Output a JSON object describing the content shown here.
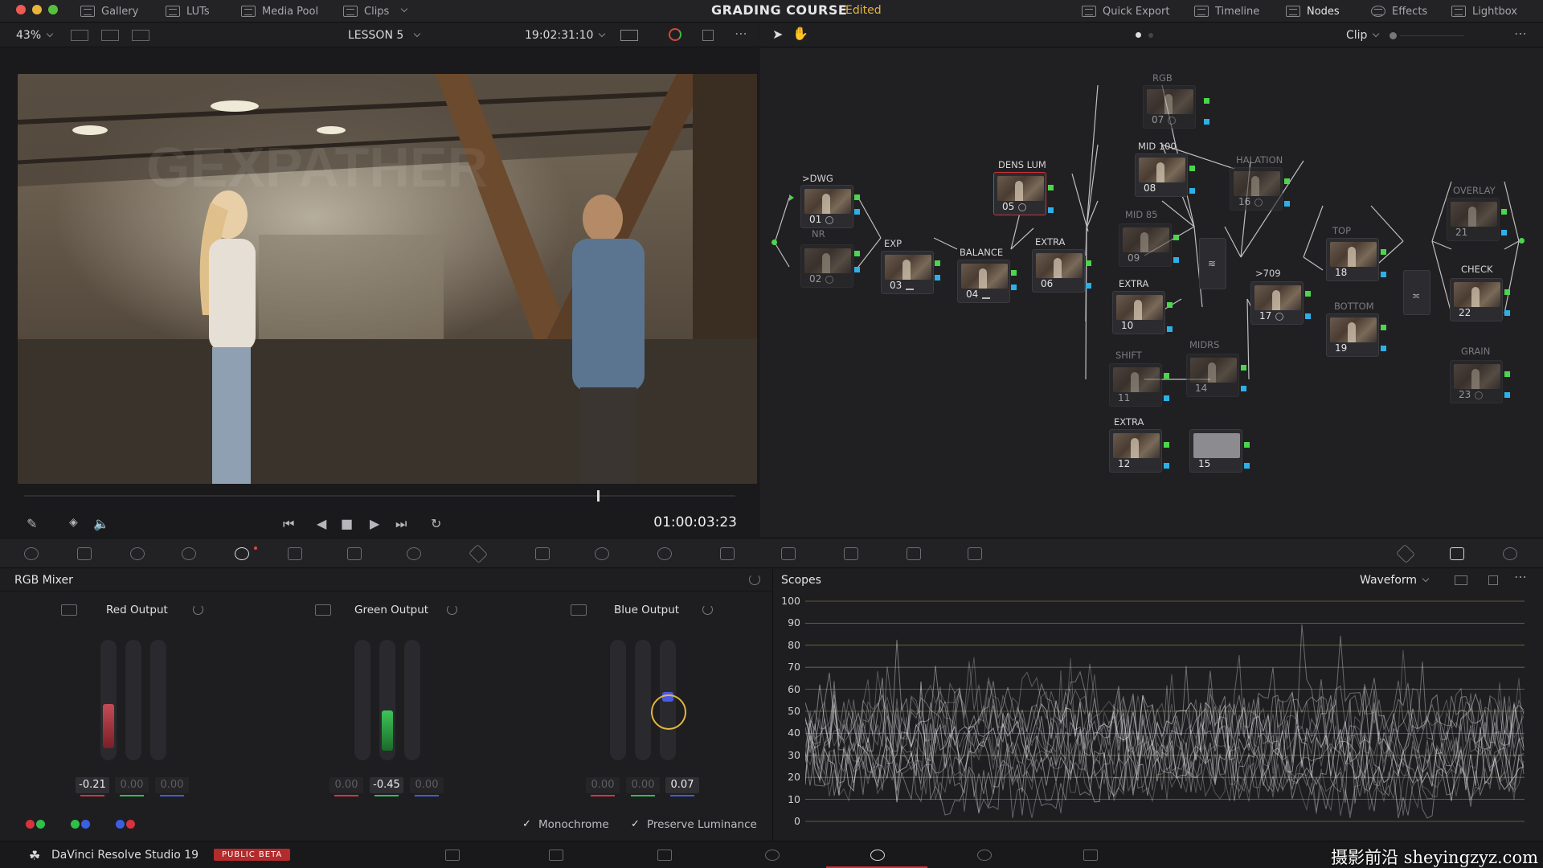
{
  "topbar": {
    "tabs": [
      {
        "label": "Gallery",
        "icon": "gallery-icon"
      },
      {
        "label": "LUTs",
        "icon": "luts-icon"
      },
      {
        "label": "Media Pool",
        "icon": "media-pool-icon"
      },
      {
        "label": "Clips",
        "icon": "clips-icon"
      }
    ],
    "project_title": "GRADING COURSE",
    "project_status": "Edited",
    "right_tabs": [
      {
        "label": "Quick Export",
        "icon": "export-icon"
      },
      {
        "label": "Timeline",
        "icon": "timeline-icon"
      },
      {
        "label": "Nodes",
        "icon": "nodes-icon"
      },
      {
        "label": "Effects",
        "icon": "effects-icon"
      },
      {
        "label": "Lightbox",
        "icon": "lightbox-icon"
      }
    ]
  },
  "viewer": {
    "zoom": "43%",
    "timeline_name": "LESSON 5",
    "source_timecode": "19:02:31:10",
    "playhead_timecode": "01:00:03:23",
    "playhead_position": 0.8
  },
  "node_editor": {
    "mode": "Clip",
    "nodes": [
      {
        "num": "01",
        "label": ">DWG"
      },
      {
        "num": "02",
        "label": "NR"
      },
      {
        "num": "03",
        "label": "EXP"
      },
      {
        "num": "04",
        "label": "BALANCE"
      },
      {
        "num": "05",
        "label": "DENS LUM"
      },
      {
        "num": "06",
        "label": "EXTRA"
      },
      {
        "num": "07",
        "label": "RGB"
      },
      {
        "num": "08",
        "label": "MID 100"
      },
      {
        "num": "09",
        "label": "MID 85"
      },
      {
        "num": "10",
        "label": "EXTRA"
      },
      {
        "num": "11",
        "label": "SHIFT"
      },
      {
        "num": "12",
        "label": "EXTRA"
      },
      {
        "num": "14",
        "label": "MIDRS"
      },
      {
        "num": "15",
        "label": ""
      },
      {
        "num": "16",
        "label": "HALATION"
      },
      {
        "num": "17",
        "label": ">709"
      },
      {
        "num": "18",
        "label": "TOP"
      },
      {
        "num": "19",
        "label": "BOTTOM"
      },
      {
        "num": "21",
        "label": "OVERLAY"
      },
      {
        "num": "22",
        "label": "CHECK"
      },
      {
        "num": "23",
        "label": "GRAIN"
      }
    ]
  },
  "rgb_mixer": {
    "title": "RGB Mixer",
    "outputs": [
      {
        "label": "Red Output",
        "values": [
          "-0.21",
          "0.00",
          "0.00"
        ]
      },
      {
        "label": "Green Output",
        "values": [
          "0.00",
          "-0.45",
          "0.00"
        ]
      },
      {
        "label": "Blue Output",
        "values": [
          "0.00",
          "0.00",
          "0.07"
        ]
      }
    ],
    "monochrome_label": "Monochrome",
    "preserve_luminance_label": "Preserve Luminance",
    "colors": {
      "red": "#d8333c",
      "green": "#2fbf4a",
      "blue": "#3a5fe0"
    }
  },
  "scopes": {
    "title": "Scopes",
    "mode": "Waveform",
    "y_ticks": [
      "100",
      "90",
      "80",
      "70",
      "60",
      "50",
      "40",
      "30",
      "20",
      "10",
      "0"
    ]
  },
  "pagebar": {
    "app_name": "DaVinci Resolve Studio 19",
    "badge": "PUBLIC BETA",
    "watermark": "摄影前沿 sheyingzyz.com"
  }
}
